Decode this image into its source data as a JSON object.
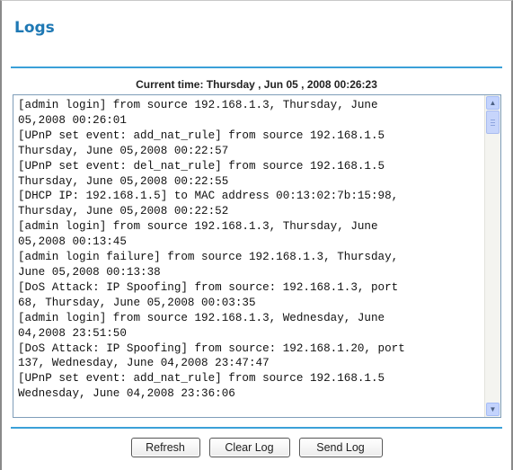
{
  "page": {
    "title": "Logs",
    "current_time": "Current time: Thursday , Jun 05 , 2008 00:26:23"
  },
  "log_lines": [
    "[admin login] from source 192.168.1.3, Thursday, June",
    "05,2008 00:26:01",
    "[UPnP set event: add_nat_rule] from source 192.168.1.5",
    "Thursday, June 05,2008 00:22:57",
    "[UPnP set event: del_nat_rule] from source 192.168.1.5",
    "Thursday, June 05,2008 00:22:55",
    "[DHCP IP: 192.168.1.5] to MAC address 00:13:02:7b:15:98,",
    "Thursday, June 05,2008 00:22:52",
    "[admin login] from source 192.168.1.3, Thursday, June",
    "05,2008 00:13:45",
    "[admin login failure] from source 192.168.1.3, Thursday,",
    "June 05,2008 00:13:38",
    "[DoS Attack: IP Spoofing] from source: 192.168.1.3, port",
    "68, Thursday, June 05,2008 00:03:35",
    "[admin login] from source 192.168.1.3, Wednesday, June",
    "04,2008 23:51:50",
    "[DoS Attack: IP Spoofing] from source: 192.168.1.20, port",
    "137, Wednesday, June 04,2008 23:47:47",
    "[UPnP set event: add_nat_rule] from source 192.168.1.5",
    "Wednesday, June 04,2008 23:36:06"
  ],
  "buttons": {
    "refresh": "Refresh",
    "clear_log": "Clear Log",
    "send_log": "Send Log"
  },
  "icons": {
    "scroll_up": "triangle-up-icon",
    "scroll_down": "triangle-down-icon"
  },
  "colors": {
    "title": "#1e78b4",
    "rule": "#3aa0d8",
    "scrollbar": "#c3d3fd"
  }
}
